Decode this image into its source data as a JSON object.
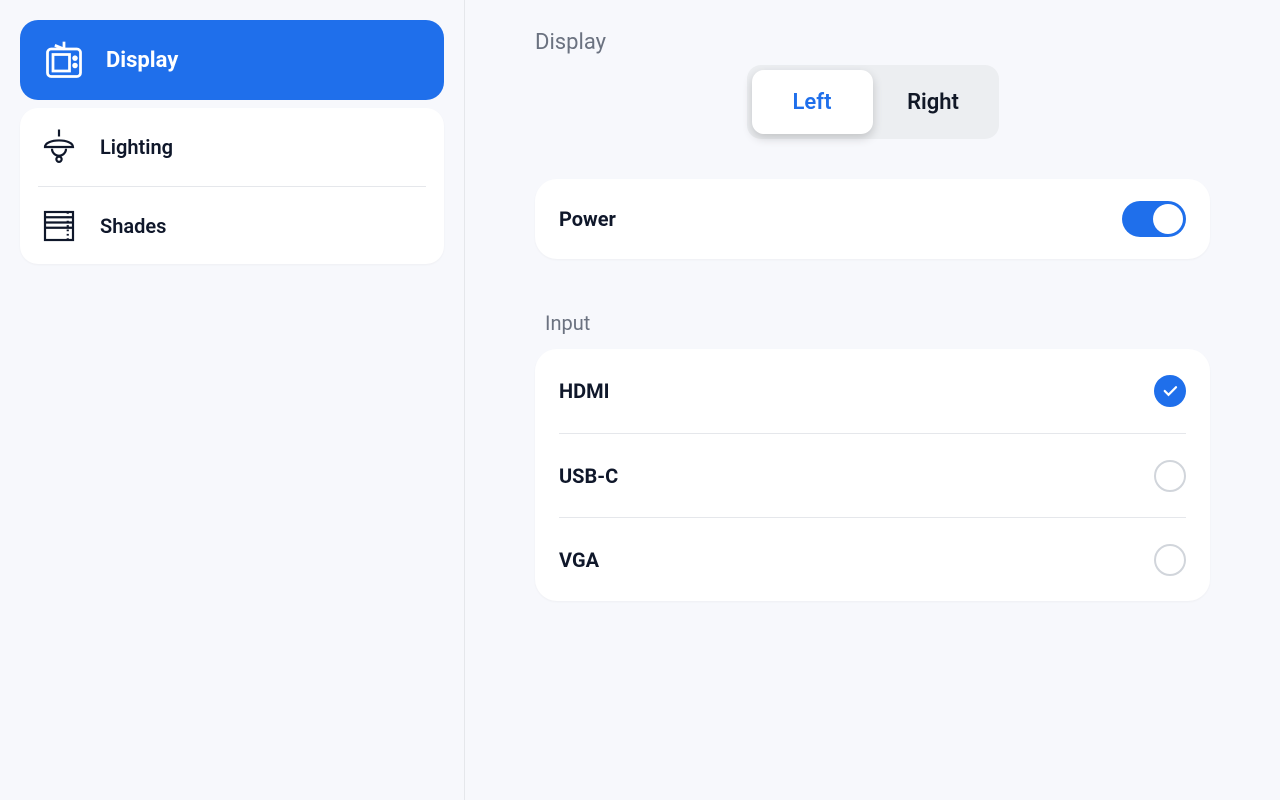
{
  "sidebar": {
    "items": [
      {
        "label": "Display",
        "selected": true
      },
      {
        "label": "Lighting",
        "selected": false
      },
      {
        "label": "Shades",
        "selected": false
      }
    ]
  },
  "page": {
    "title": "Display",
    "tabs": {
      "left": "Left",
      "right": "Right",
      "active": "left"
    },
    "power": {
      "label": "Power",
      "on": true
    },
    "input_section_title": "Input",
    "inputs": [
      {
        "label": "HDMI",
        "selected": true
      },
      {
        "label": "USB-C",
        "selected": false
      },
      {
        "label": "VGA",
        "selected": false
      }
    ]
  }
}
